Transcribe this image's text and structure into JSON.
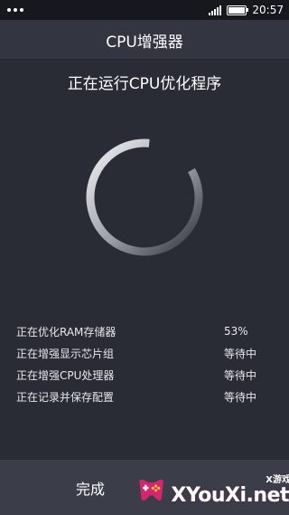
{
  "status_bar": {
    "time": "20:57"
  },
  "app": {
    "title": "CPU增强器"
  },
  "main": {
    "heading": "正在运行CPU优化程序",
    "tasks": [
      {
        "label": "正在优化RAM存储器",
        "status": "53%"
      },
      {
        "label": "正在增强显示芯片组",
        "status": "等待中"
      },
      {
        "label": "正在增强CPU处理器",
        "status": "等待中"
      },
      {
        "label": "正在记录并保存配置",
        "status": "等待中"
      }
    ],
    "progress_fraction": 0.53
  },
  "footer": {
    "done_label": "完成"
  },
  "watermark": {
    "small": "X游戏",
    "big": "XYouXi.net"
  },
  "colors": {
    "background": "#2a2c35",
    "titlebar": "#333540",
    "footer": "#3b3d48",
    "ring_start": "#e0e0e4",
    "ring_end": "#3a3c45"
  }
}
